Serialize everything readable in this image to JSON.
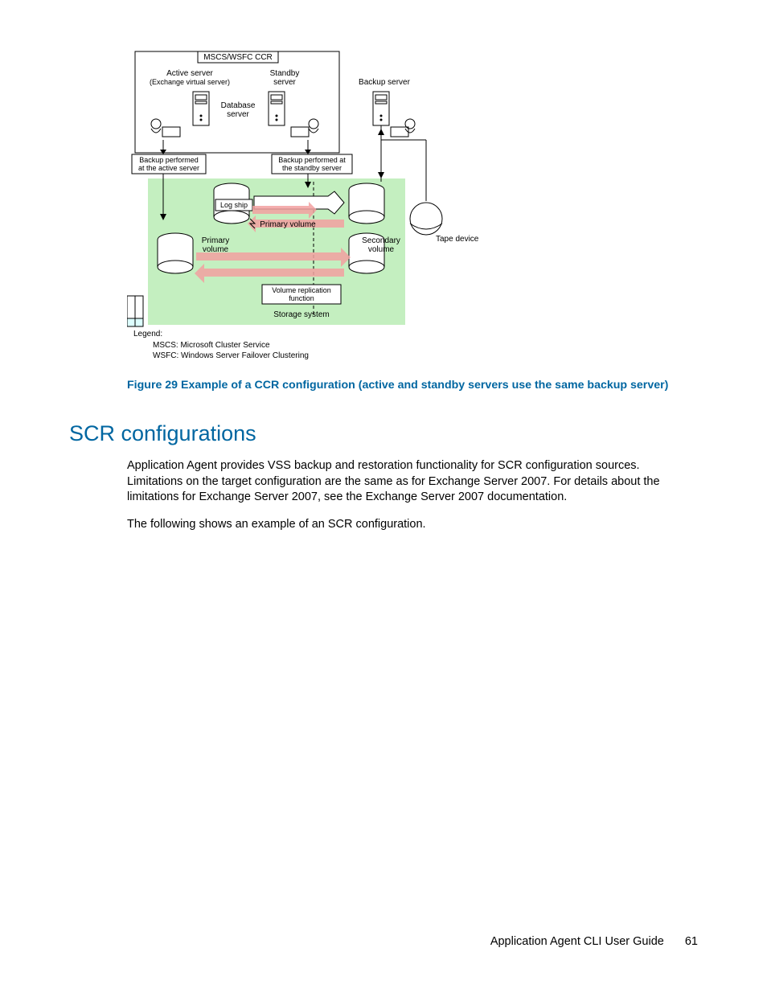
{
  "diagram": {
    "cluster_header": "MSCS/WSFC CCR",
    "active_server_l1": "Active server",
    "active_server_l2": "(Exchange virtual server)",
    "standby_server_l1": "Standby",
    "standby_server_l2": "server",
    "backup_server": "Backup server",
    "database_server_l1": "Database",
    "database_server_l2": "server",
    "backup_active_l1": "Backup performed",
    "backup_active_l2": "at the active server",
    "backup_standby_l1": "Backup performed at",
    "backup_standby_l2": "the standby server",
    "log_ship": "Log ship",
    "primary_volume_top": "Primary volume",
    "primary_l1": "Primary",
    "primary_l2": "volume",
    "secondary_l1": "Secondary",
    "secondary_l2": "volume",
    "tape_device": "Tape device",
    "vol_repl_l1": "Volume replication",
    "vol_repl_l2": "function",
    "storage_system": "Storage system",
    "legend_header": "Legend:",
    "legend_mscs": "MSCS: Microsoft Cluster Service",
    "legend_wsfc": "WSFC: Windows Server Failover Clustering"
  },
  "caption": "Figure 29 Example of a CCR configuration (active and standby servers use the same backup server)",
  "section_heading": "SCR configurations",
  "para1": "Application Agent provides VSS backup and restoration functionality for SCR configuration sources. Limitations on the target configuration are the same as for Exchange Server 2007. For details about the limitations for Exchange Server 2007, see the Exchange Server 2007 documentation.",
  "para2": "The following shows an example of an SCR configuration.",
  "footer_title": "Application Agent CLI User Guide",
  "page_number": "61"
}
